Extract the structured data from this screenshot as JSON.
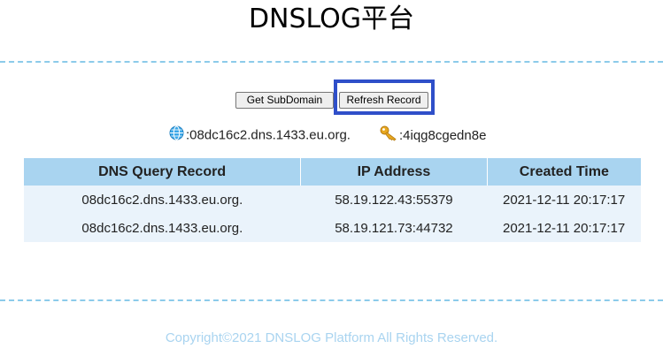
{
  "header": {
    "title": "DNSLOG平台"
  },
  "toolbar": {
    "get_subdomain_label": "Get SubDomain",
    "refresh_record_label": "Refresh Record"
  },
  "info": {
    "domain": ":08dc16c2.dns.1433.eu.org.",
    "domain_icon": "globe-icon",
    "token": ":4iqg8cgedn8e",
    "token_icon": "key-icon"
  },
  "table": {
    "headers": [
      "DNS Query Record",
      "IP Address",
      "Created Time"
    ],
    "rows": [
      [
        "08dc16c2.dns.1433.eu.org.",
        "58.19.122.43:55379",
        "2021-12-11 20:17:17"
      ],
      [
        "08dc16c2.dns.1433.eu.org.",
        "58.19.121.73:44732",
        "2021-12-11 20:17:17"
      ]
    ]
  },
  "footer": {
    "copyright": "Copyright©2021 DNSLOG Platform All Rights Reserved."
  },
  "colors": {
    "divider": "#8ccbea",
    "table_header": "#a9d4f0",
    "table_row": "#eaf3fb",
    "highlight": "#2f4fc9",
    "footer_text": "#a9d4f0"
  }
}
